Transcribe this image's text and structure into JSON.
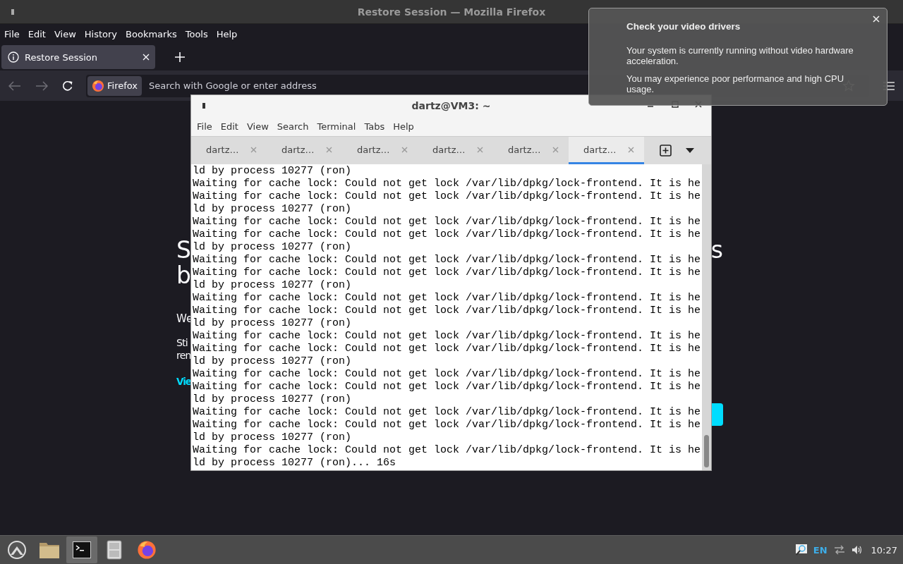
{
  "firefox": {
    "title": "Restore Session — Mozilla Firefox",
    "menu": [
      "File",
      "Edit",
      "View",
      "History",
      "Bookmarks",
      "Tools",
      "Help"
    ],
    "tabs": [
      {
        "label": "Restore Session",
        "selected": true
      }
    ],
    "address": {
      "identity": "Firefox",
      "placeholder": "Search with Google or enter address"
    },
    "page": {
      "heading_line_1_start": "S",
      "heading_line_1_end": "s",
      "heading_line_2_start": "b",
      "paragraph_1_start": "We",
      "paragraph_2_lines": [
        "Sti",
        "ren"
      ],
      "link_start": "Vie"
    }
  },
  "terminal": {
    "title": "dartz@VM3: ~",
    "menu": [
      "File",
      "Edit",
      "View",
      "Search",
      "Terminal",
      "Tabs",
      "Help"
    ],
    "tabs": [
      {
        "label": "dartz…",
        "selected": false
      },
      {
        "label": "dartz…",
        "selected": false
      },
      {
        "label": "dartz…",
        "selected": false
      },
      {
        "label": "dartz…",
        "selected": false
      },
      {
        "label": "dartz…",
        "selected": false
      },
      {
        "label": "dartz…",
        "selected": true
      }
    ],
    "lines": [
      "ld by process 10277 (ron)",
      "Waiting for cache lock: Could not get lock /var/lib/dpkg/lock-frontend. It is he",
      "Waiting for cache lock: Could not get lock /var/lib/dpkg/lock-frontend. It is he",
      "ld by process 10277 (ron)",
      "Waiting for cache lock: Could not get lock /var/lib/dpkg/lock-frontend. It is he",
      "Waiting for cache lock: Could not get lock /var/lib/dpkg/lock-frontend. It is he",
      "ld by process 10277 (ron)",
      "Waiting for cache lock: Could not get lock /var/lib/dpkg/lock-frontend. It is he",
      "Waiting for cache lock: Could not get lock /var/lib/dpkg/lock-frontend. It is he",
      "ld by process 10277 (ron)",
      "Waiting for cache lock: Could not get lock /var/lib/dpkg/lock-frontend. It is he",
      "Waiting for cache lock: Could not get lock /var/lib/dpkg/lock-frontend. It is he",
      "ld by process 10277 (ron)",
      "Waiting for cache lock: Could not get lock /var/lib/dpkg/lock-frontend. It is he",
      "Waiting for cache lock: Could not get lock /var/lib/dpkg/lock-frontend. It is he",
      "ld by process 10277 (ron)",
      "Waiting for cache lock: Could not get lock /var/lib/dpkg/lock-frontend. It is he",
      "Waiting for cache lock: Could not get lock /var/lib/dpkg/lock-frontend. It is he",
      "ld by process 10277 (ron)",
      "Waiting for cache lock: Could not get lock /var/lib/dpkg/lock-frontend. It is he",
      "Waiting for cache lock: Could not get lock /var/lib/dpkg/lock-frontend. It is he",
      "ld by process 10277 (ron)",
      "Waiting for cache lock: Could not get lock /var/lib/dpkg/lock-frontend. It is he",
      "ld by process 10277 (ron)... 16s"
    ]
  },
  "notification": {
    "title": "Check your video drivers",
    "paragraphs": [
      "Your system is currently running without video hardware acceleration.",
      "You may experience poor performance and high CPU usage."
    ]
  },
  "taskbar": {
    "apps": [
      {
        "kind": "launcher",
        "selected": false
      },
      {
        "kind": "folder",
        "selected": false
      },
      {
        "kind": "terminal",
        "selected": true
      },
      {
        "kind": "cabinet",
        "selected": false
      },
      {
        "kind": "firefox",
        "selected": false
      }
    ],
    "keyboard_layout": "EN",
    "clock": "10:27"
  }
}
